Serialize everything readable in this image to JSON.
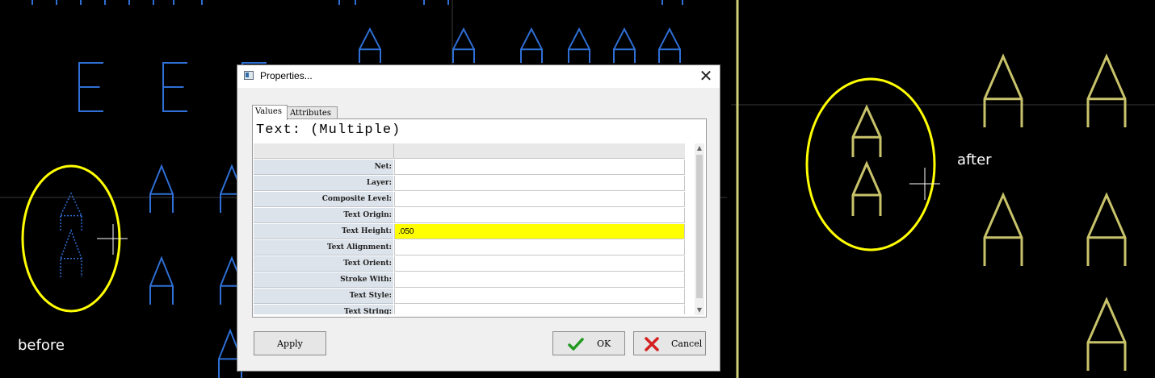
{
  "annotations": {
    "before": "before",
    "after": "after"
  },
  "cad_glyphs": {
    "letter_e": "E",
    "letter_a": "A"
  },
  "colors": {
    "background": "#000000",
    "blue_text": "#2f6fd6",
    "yellow_text": "#c8c36a",
    "highlight_ellipse": "#ffff00",
    "divider": "#cfcf77"
  },
  "dialog": {
    "title": "Properties...",
    "app_icon": "window-icon",
    "close_icon": "close-x",
    "tabs": [
      {
        "label": "Values",
        "active": true
      },
      {
        "label": "Attributes",
        "active": false
      }
    ],
    "heading": "Text: (Multiple)",
    "rows": [
      {
        "label": "Net:",
        "value": ""
      },
      {
        "label": "Layer:",
        "value": ""
      },
      {
        "label": "Composite Level:",
        "value": ""
      },
      {
        "label": "Text Origin:",
        "value": ""
      },
      {
        "label": "Text Height:",
        "value": ".050",
        "highlighted": true
      },
      {
        "label": "Text Alignment:",
        "value": ""
      },
      {
        "label": "Text Orient:",
        "value": ""
      },
      {
        "label": "Stroke With:",
        "value": ""
      },
      {
        "label": "Text Style:",
        "value": ""
      },
      {
        "label": "Text String:",
        "value": ""
      }
    ],
    "buttons": {
      "apply": "Apply",
      "ok": "OK",
      "cancel": "Cancel"
    },
    "icons": {
      "ok": "green-check-icon",
      "cancel": "red-x-icon"
    }
  }
}
